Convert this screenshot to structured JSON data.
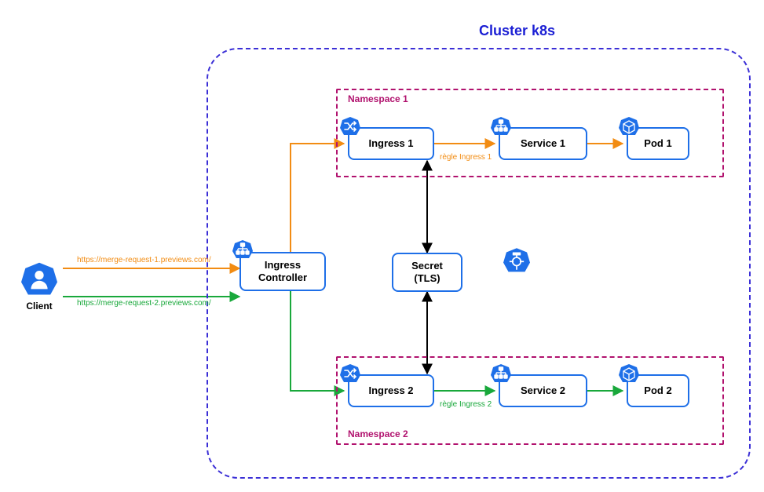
{
  "cluster": {
    "title": "Cluster k8s"
  },
  "namespaces": {
    "ns1": {
      "label": "Namespace 1"
    },
    "ns2": {
      "label": "Namespace 2"
    }
  },
  "client": {
    "label": "Client"
  },
  "nodes": {
    "ingressController": {
      "line1": "Ingress",
      "line2": "Controller"
    },
    "secret": {
      "line1": "Secret",
      "line2": "(TLS)"
    },
    "ingress1": {
      "label": "Ingress 1"
    },
    "service1": {
      "label": "Service 1"
    },
    "pod1": {
      "label": "Pod 1"
    },
    "ingress2": {
      "label": "Ingress 2"
    },
    "service2": {
      "label": "Service 2"
    },
    "pod2": {
      "label": "Pod 2"
    }
  },
  "edges": {
    "url1": "https://merge-request-1.previews.com/",
    "url2": "https://merge-request-2.previews.com/",
    "rule1": "règle Ingress 1",
    "rule2": "règle Ingress 2"
  },
  "colors": {
    "k8sBlue": "#1e6fe8",
    "clusterBlue": "#3b2fd6",
    "nsMagenta": "#b1126e",
    "orange": "#f28c13",
    "green": "#19a83b",
    "black": "#000000"
  },
  "icons": {
    "client": "user-icon",
    "router": "shuffle-icon",
    "service": "sitemap-icon",
    "pod": "cube-icon",
    "deploy": "ship-wheel-icon",
    "ingressController": "sitemap-icon"
  }
}
